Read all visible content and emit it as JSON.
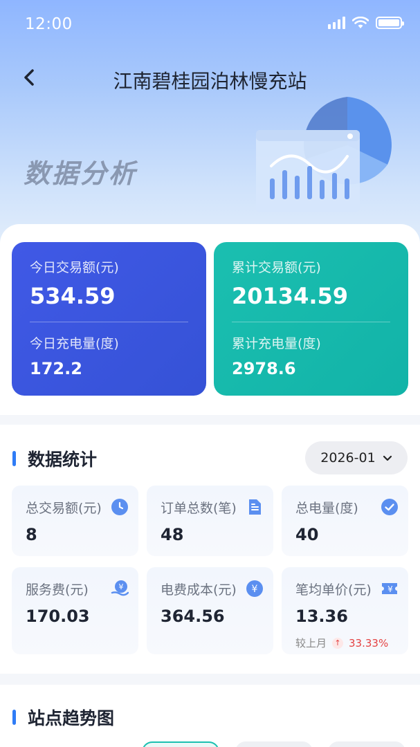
{
  "status_bar": {
    "time": "12:00"
  },
  "nav": {
    "title": "江南碧桂园泊林慢充站"
  },
  "hero": {
    "title": "数据分析"
  },
  "cards": {
    "today": {
      "amount_label": "今日交易额(元)",
      "amount": "534.59",
      "energy_label": "今日充电量(度)",
      "energy": "172.2"
    },
    "total": {
      "amount_label": "累计交易额(元)",
      "amount": "20134.59",
      "energy_label": "累计充电量(度)",
      "energy": "2978.6"
    }
  },
  "stats_section": {
    "title": "数据统计",
    "date_selector": "2026-01",
    "items": [
      {
        "label": "总交易额(元)",
        "value": "8",
        "icon": "clock-icon"
      },
      {
        "label": "订单总数(笔)",
        "value": "48",
        "icon": "document-icon"
      },
      {
        "label": "总电量(度)",
        "value": "40",
        "icon": "check-circle-icon"
      },
      {
        "label": "服务费(元)",
        "value": "170.03",
        "icon": "yuan-hand-icon"
      },
      {
        "label": "电费成本(元)",
        "value": "364.56",
        "icon": "yuan-circle-icon"
      },
      {
        "label": "笔均单价(元)",
        "value": "13.36",
        "icon": "yuan-ticket-icon",
        "compare_label": "较上月",
        "compare_value": "33.33%"
      }
    ]
  },
  "trend_section": {
    "title": "站点趋势图"
  },
  "colors": {
    "accent": "#2f7cf6",
    "card_blue": "#3f58e4",
    "card_teal": "#16bbad",
    "up": "#e44141"
  }
}
